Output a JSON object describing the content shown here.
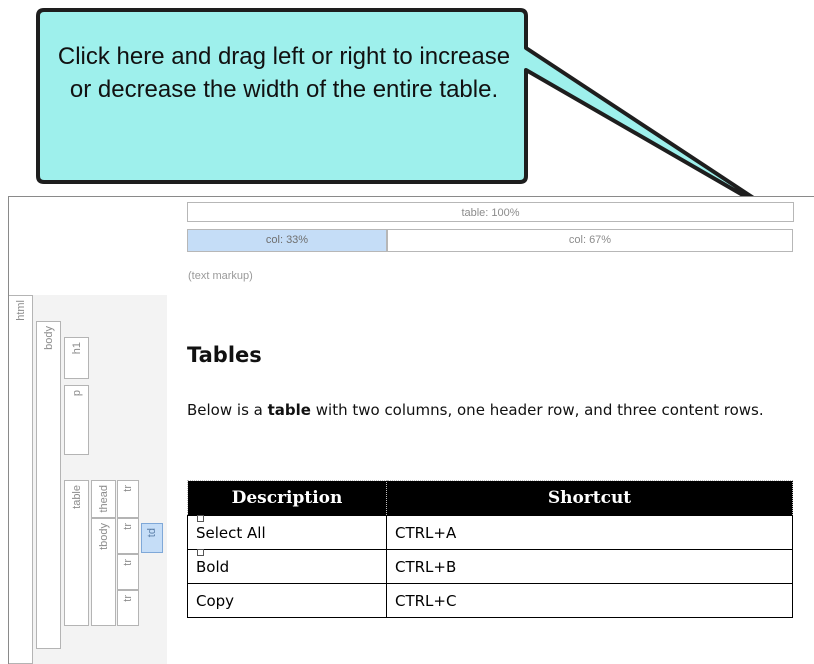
{
  "callout": {
    "text": "Click here and drag left or right to increase or decrease the width of the entire table.",
    "fill_color": "#9ef0ec",
    "border_color": "#1e1e1e"
  },
  "structure_bars": {
    "table_label": "table: 100%",
    "col1_label": "col: 33%",
    "col2_label": "col: 67%",
    "markup_label": "(text markup)",
    "selected_color": "#c5ddf7",
    "vertical_labels": [
      "html",
      "body",
      "h1",
      "p",
      "table",
      "tbody",
      "thead",
      "tr",
      "tr",
      "tr",
      "tr",
      "td"
    ]
  },
  "document": {
    "heading": "Tables",
    "para_before": "Below is a ",
    "para_bold": "table",
    "para_after": " with two columns, one header row, and three content rows.",
    "table": {
      "headers": [
        "Description",
        "Shortcut"
      ],
      "rows": [
        [
          "Select All",
          "CTRL+A"
        ],
        [
          "Bold",
          "CTRL+B"
        ],
        [
          "Copy",
          "CTRL+C"
        ]
      ]
    }
  }
}
